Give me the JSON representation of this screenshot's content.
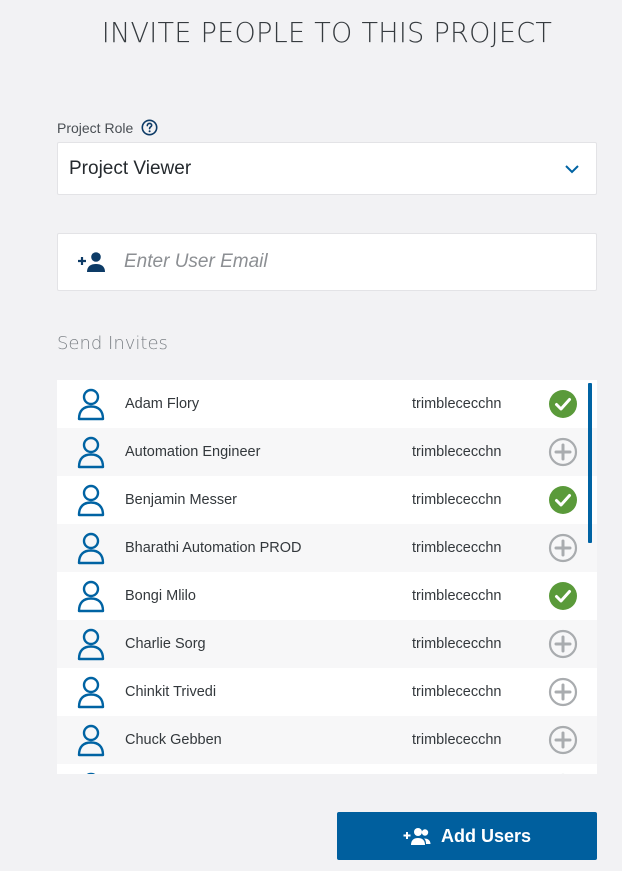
{
  "title": "INVITE PEOPLE TO THIS PROJECT",
  "role": {
    "label": "Project Role",
    "help_icon": "help-circle-icon",
    "value": "Project Viewer",
    "chevron_icon": "chevron-down-icon"
  },
  "email": {
    "placeholder": "Enter User Email",
    "icon": "add-person-icon"
  },
  "invites": {
    "label": "Send Invites",
    "users": [
      {
        "name": "Adam Flory",
        "company": "trimblececchn",
        "selected": true
      },
      {
        "name": "Automation Engineer",
        "company": "trimblececchn",
        "selected": false
      },
      {
        "name": "Benjamin Messer",
        "company": "trimblececchn",
        "selected": true
      },
      {
        "name": "Bharathi Automation PROD",
        "company": "trimblececchn",
        "selected": false
      },
      {
        "name": "Bongi Mlilo",
        "company": "trimblececchn",
        "selected": true
      },
      {
        "name": "Charlie Sorg",
        "company": "trimblececchn",
        "selected": false
      },
      {
        "name": "Chinkit Trivedi",
        "company": "trimblececchn",
        "selected": false
      },
      {
        "name": "Chuck Gebben",
        "company": "trimblececchn",
        "selected": false
      }
    ]
  },
  "add_button": {
    "label": "Add Users",
    "icon": "add-people-icon"
  },
  "colors": {
    "primary": "#005f9e",
    "check": "#5a9a3a",
    "plus": "#a9acaf",
    "avatar": "#0063a3"
  }
}
